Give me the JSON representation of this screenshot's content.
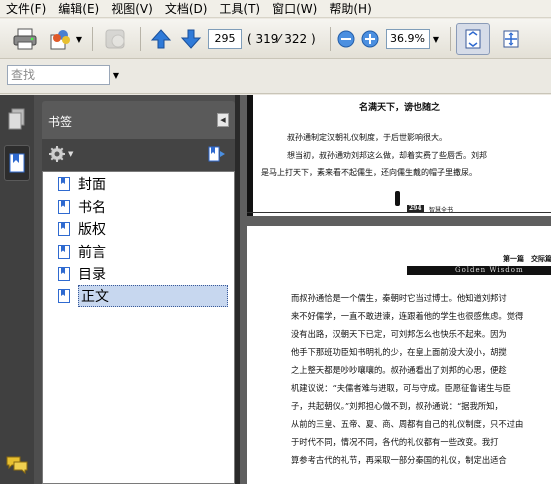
{
  "menu": [
    {
      "label": "文件(F)"
    },
    {
      "label": "编辑(E)"
    },
    {
      "label": "视图(V)"
    },
    {
      "label": "文档(D)"
    },
    {
      "label": "工具(T)"
    },
    {
      "label": "窗口(W)"
    },
    {
      "label": "帮助(H)"
    }
  ],
  "toolbar": {
    "page_current": "295",
    "page_count": "( 319⁄ 322 )",
    "zoom": "36.9%"
  },
  "search": {
    "placeholder": "查找"
  },
  "bookmarks": {
    "title": "书签",
    "items": [
      {
        "label": "封面"
      },
      {
        "label": "书名"
      },
      {
        "label": "版权"
      },
      {
        "label": "前言"
      },
      {
        "label": "目录"
      },
      {
        "label": "正文"
      }
    ],
    "selected_index": 5
  },
  "document": {
    "page1": {
      "heading": "名满天下，谤也随之",
      "lines": [
        "叔孙通制定汉朝礼仪制度，于后世影响很大。",
        "想当初，叔孙通劝刘邦这么做，却着实费了些唇舌。刘邦",
        "是马上打天下，素来看不起儒生，还向儒生戴的帽子里撒尿。"
      ],
      "page_number": "294",
      "footer_text": "智慧全书"
    },
    "page2": {
      "chapter": "第一篇　交际篇",
      "banner": "Golden Wisdom",
      "lines": [
        "而叔孙通恰是一个儒生，秦朝时它当过博士。他知道刘邦讨",
        "来不好儒学，一直不敢进谏，连跟着他的学生也很感焦虑。觉得",
        "没有出路，汉朝天下已定，可刘邦怎么也快乐不起来。因为",
        "他手下那班功臣知书明礼的少，在皇上面前没大没小，胡搅",
        "之上整天都是吵吵嚷嚷的。叔孙通看出了刘邦的心思，便趁",
        "机建议说：“夫儒者难与进取，可与守成。臣愿征鲁诸生与臣",
        "子，共起朝仪。”刘邦担心做不到，叔孙通说：“据我所知，",
        "从前的三皇、五帝、夏、商、周都有自己的礼仪制度，只不过由",
        "于时代不同，情况不同，各代的礼仪都有一些改变。我打",
        "算参考古代的礼节，再采取一部分秦国的礼仪，制定出适合"
      ]
    }
  }
}
